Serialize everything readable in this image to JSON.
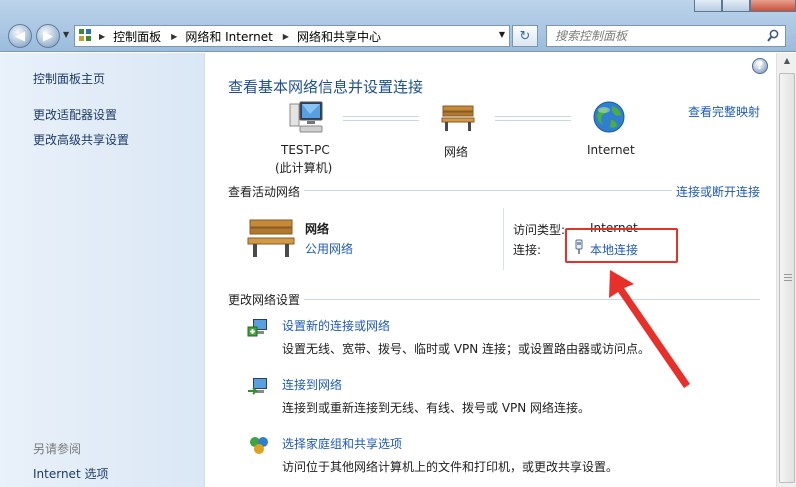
{
  "address_bar": {
    "crumbs": [
      "控制面板",
      "网络和 Internet",
      "网络和共享中心"
    ]
  },
  "search": {
    "placeholder": "搜索控制面板"
  },
  "left_nav": {
    "home": "控制面板主页",
    "items": [
      "更改适配器设置",
      "更改高级共享设置"
    ],
    "see_also_heading": "另请参阅",
    "see_also_items": [
      "Internet 选项"
    ]
  },
  "main": {
    "title": "查看基本网络信息并设置连接",
    "full_map_link": "查看完整映射",
    "map": {
      "computer_name": "TEST-PC",
      "computer_sub": "(此计算机)",
      "network_label": "网络",
      "internet_label": "Internet"
    },
    "active_networks": {
      "heading": "查看活动网络",
      "connect_link": "连接或断开连接",
      "network_name": "网络",
      "network_type": "公用网络",
      "access_type_label": "访问类型:",
      "access_type_value": "Internet",
      "connections_label": "连接:",
      "connection_value": "本地连接"
    },
    "change_settings": {
      "heading": "更改网络设置",
      "tasks": [
        {
          "title": "设置新的连接或网络",
          "desc": "设置无线、宽带、拨号、临时或 VPN 连接；或设置路由器或访问点。"
        },
        {
          "title": "连接到网络",
          "desc": "连接到或重新连接到无线、有线、拨号或 VPN 网络连接。"
        },
        {
          "title": "选择家庭组和共享选项",
          "desc": "访问位于其他网络计算机上的文件和打印机，或更改共享设置。"
        }
      ]
    }
  },
  "colors": {
    "link": "#1f5bb8",
    "title": "#1e4f8f",
    "highlight": "#e8302a"
  }
}
